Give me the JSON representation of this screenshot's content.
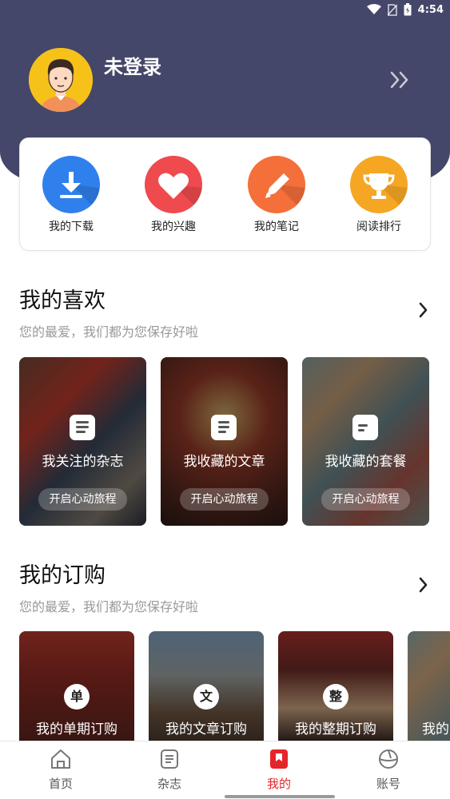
{
  "status_bar": {
    "time": "4:54"
  },
  "profile": {
    "username": "未登录"
  },
  "quick_actions": [
    {
      "label": "我的下载",
      "icon": "download-icon",
      "color": "#2f80ed"
    },
    {
      "label": "我的兴趣",
      "icon": "heart-icon",
      "color": "#ef4a4d"
    },
    {
      "label": "我的笔记",
      "icon": "pencil-icon",
      "color": "#f56f3a"
    },
    {
      "label": "阅读排行",
      "icon": "trophy-icon",
      "color": "#f5a623"
    }
  ],
  "favorites": {
    "title": "我的喜欢",
    "subtitle": "您的最爱，我们都为您保存好啦",
    "cards": [
      {
        "title": "我关注的杂志",
        "button": "开启心动旅程",
        "icon": "magazine-icon"
      },
      {
        "title": "我收藏的文章",
        "button": "开启心动旅程",
        "icon": "article-icon"
      },
      {
        "title": "我收藏的套餐",
        "button": "开启心动旅程",
        "icon": "bundle-icon"
      }
    ]
  },
  "subscriptions": {
    "title": "我的订购",
    "subtitle": "您的最爱，我们都为您保存好啦",
    "cards": [
      {
        "badge": "单",
        "title": "我的单期订购"
      },
      {
        "badge": "文",
        "title": "我的文章订购"
      },
      {
        "badge": "整",
        "title": "我的整期订购"
      },
      {
        "badge": "",
        "title": "我的"
      }
    ]
  },
  "bottom_nav": [
    {
      "label": "首页",
      "icon": "home-icon",
      "active": false
    },
    {
      "label": "杂志",
      "icon": "magazine-icon",
      "active": false
    },
    {
      "label": "我的",
      "icon": "bookmark-icon",
      "active": true
    },
    {
      "label": "账号",
      "icon": "account-icon",
      "active": false
    }
  ],
  "colors": {
    "header": "#44476a",
    "accent": "#e6242b"
  }
}
